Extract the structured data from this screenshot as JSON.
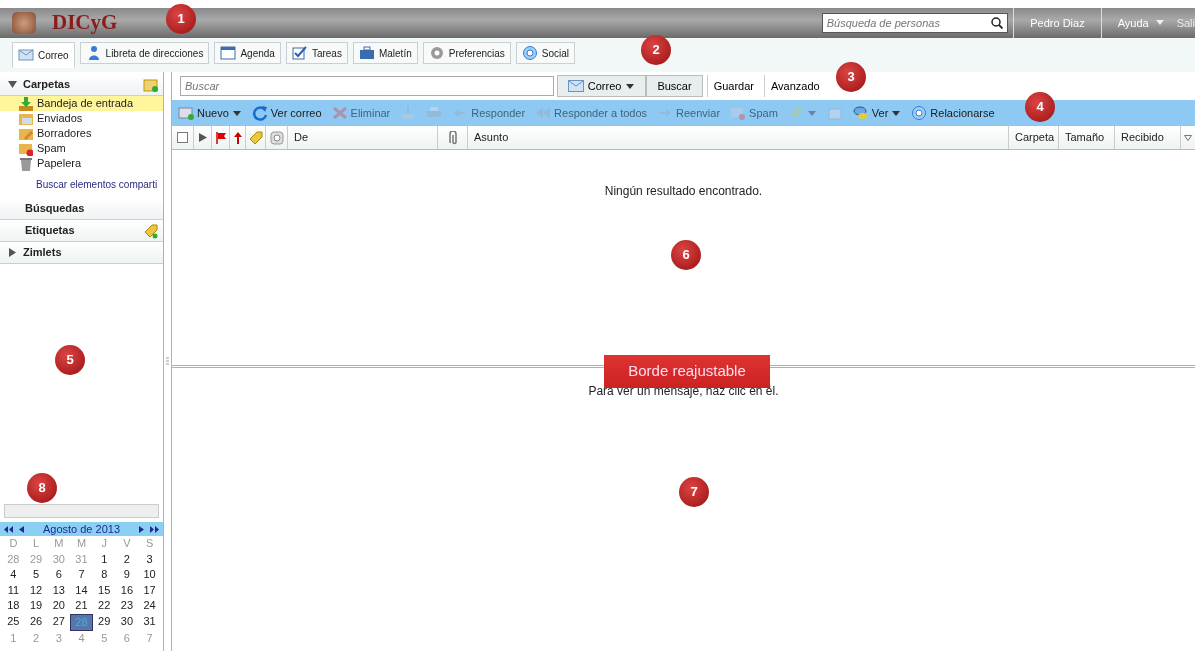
{
  "topbar": {
    "logo_text": "DICyG",
    "people_search": {
      "placeholder": "Búsqueda de personas"
    },
    "user": "Pedro Diaz",
    "help": "Ayuda",
    "logout": "Sali"
  },
  "tabs": [
    {
      "label": "Correo",
      "selected": true
    },
    {
      "label": "Libreta de direcciones",
      "selected": false
    },
    {
      "label": "Agenda",
      "selected": false
    },
    {
      "label": "Tareas",
      "selected": false
    },
    {
      "label": "Maletín",
      "selected": false
    },
    {
      "label": "Preferencias",
      "selected": false
    },
    {
      "label": "Social",
      "selected": false
    }
  ],
  "sidebar": {
    "sections": [
      {
        "title": "Carpetas",
        "expanded": true,
        "folders": [
          {
            "label": "Bandeja de entrada",
            "selected": true
          },
          {
            "label": "Enviados",
            "selected": false
          },
          {
            "label": "Borradores",
            "selected": false
          },
          {
            "label": "Spam",
            "selected": false
          },
          {
            "label": "Papelera",
            "selected": false
          }
        ],
        "link": "Buscar elementos comparti"
      },
      {
        "title": "Búsquedas"
      },
      {
        "title": "Etiquetas"
      },
      {
        "title": "Zimlets",
        "expanded": false
      }
    ]
  },
  "search": {
    "placeholder": "Buscar",
    "scope": "Correo",
    "buttons": [
      "Buscar",
      "Guardar",
      "Avanzado"
    ]
  },
  "toolbar": [
    {
      "label": "Nuevo",
      "disabled": false,
      "dropdown": true
    },
    {
      "label": "Ver correo",
      "disabled": false,
      "dropdown": false
    },
    {
      "label": "Eliminar",
      "disabled": true,
      "dropdown": false
    },
    {
      "disabled": true,
      "dropdown": false
    },
    {
      "disabled": true,
      "dropdown": false
    },
    {
      "label": "Responder",
      "disabled": true,
      "dropdown": false
    },
    {
      "label": "Responder a todos",
      "disabled": true,
      "dropdown": false
    },
    {
      "label": "Reenviar",
      "disabled": true,
      "dropdown": false
    },
    {
      "label": "Spam",
      "disabled": true,
      "dropdown": false
    },
    {
      "disabled": true,
      "dropdown": true
    },
    {
      "disabled": true,
      "dropdown": false
    },
    {
      "label": "Ver",
      "disabled": false,
      "dropdown": true
    },
    {
      "label": "Relacionarse",
      "disabled": false,
      "dropdown": false
    }
  ],
  "table": {
    "select_all": {
      "checked": false
    },
    "columns": [
      "De",
      "Asunto",
      "Carpeta",
      "Tamaño",
      "Recibido"
    ],
    "empty_message": "Ningún resultado encontrado."
  },
  "splitter_label": "Borde reajustable",
  "reading_pane": {
    "message": "Para ver un mensaje, haz clic en él."
  },
  "calendar": {
    "title": "Agosto de 2013",
    "weekdays": [
      "D",
      "L",
      "M",
      "M",
      "J",
      "V",
      "S"
    ],
    "weeks": [
      [
        {
          "d": "28",
          "muted": true,
          "selected": false
        },
        {
          "d": "29",
          "muted": true,
          "selected": false
        },
        {
          "d": "30",
          "muted": true,
          "selected": false
        },
        {
          "d": "31",
          "muted": true,
          "selected": false
        },
        {
          "d": "1",
          "muted": false,
          "selected": false
        },
        {
          "d": "2",
          "muted": false,
          "selected": false
        },
        {
          "d": "3",
          "muted": false,
          "selected": false
        }
      ],
      [
        {
          "d": "4",
          "muted": false,
          "selected": false
        },
        {
          "d": "5",
          "muted": false,
          "selected": false
        },
        {
          "d": "6",
          "muted": false,
          "selected": false
        },
        {
          "d": "7",
          "muted": false,
          "selected": false
        },
        {
          "d": "8",
          "muted": false,
          "selected": false
        },
        {
          "d": "9",
          "muted": false,
          "selected": false
        },
        {
          "d": "10",
          "muted": false,
          "selected": false
        }
      ],
      [
        {
          "d": "11",
          "muted": false,
          "selected": false
        },
        {
          "d": "12",
          "muted": false,
          "selected": false
        },
        {
          "d": "13",
          "muted": false,
          "selected": false
        },
        {
          "d": "14",
          "muted": false,
          "selected": false
        },
        {
          "d": "15",
          "muted": false,
          "selected": false
        },
        {
          "d": "16",
          "muted": false,
          "selected": false
        },
        {
          "d": "17",
          "muted": false,
          "selected": false
        }
      ],
      [
        {
          "d": "18",
          "muted": false,
          "selected": false
        },
        {
          "d": "19",
          "muted": false,
          "selected": false
        },
        {
          "d": "20",
          "muted": false,
          "selected": false
        },
        {
          "d": "21",
          "muted": false,
          "selected": false
        },
        {
          "d": "22",
          "muted": false,
          "selected": false
        },
        {
          "d": "23",
          "muted": false,
          "selected": false
        },
        {
          "d": "24",
          "muted": false,
          "selected": false
        }
      ],
      [
        {
          "d": "25",
          "muted": false,
          "selected": false
        },
        {
          "d": "26",
          "muted": false,
          "selected": false
        },
        {
          "d": "27",
          "muted": false,
          "selected": false
        },
        {
          "d": "28",
          "muted": false,
          "selected": true
        },
        {
          "d": "29",
          "muted": false,
          "selected": false
        },
        {
          "d": "30",
          "muted": false,
          "selected": false
        },
        {
          "d": "31",
          "muted": false,
          "selected": false
        }
      ],
      [
        {
          "d": "1",
          "muted": true,
          "selected": false
        },
        {
          "d": "2",
          "muted": true,
          "selected": false
        },
        {
          "d": "3",
          "muted": true,
          "selected": false
        },
        {
          "d": "4",
          "muted": true,
          "selected": false
        },
        {
          "d": "5",
          "muted": true,
          "selected": false
        },
        {
          "d": "6",
          "muted": true,
          "selected": false
        },
        {
          "d": "7",
          "muted": true,
          "selected": false
        }
      ]
    ]
  },
  "callouts": [
    {
      "label": "1"
    },
    {
      "label": "2"
    },
    {
      "label": "3"
    },
    {
      "label": "4"
    },
    {
      "label": "5"
    },
    {
      "label": "6"
    },
    {
      "label": "7"
    },
    {
      "label": "8"
    }
  ]
}
